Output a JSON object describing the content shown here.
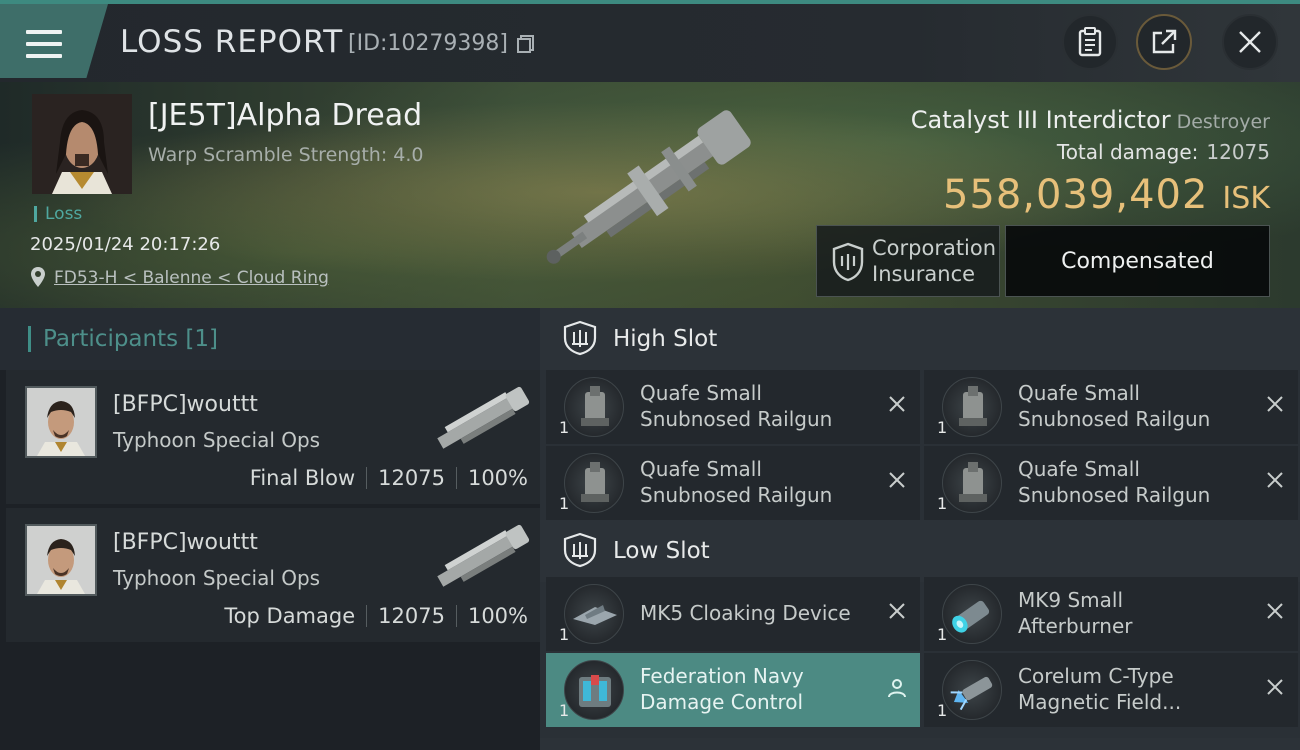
{
  "header": {
    "title": "LOSS REPORT",
    "report_id": "[ID:10279398]",
    "icons": [
      "menu-icon",
      "copy-icon",
      "clipboard-icon",
      "share-icon",
      "close-icon"
    ]
  },
  "victim": {
    "name": "[JE5T]Alpha Dread",
    "warp_scramble": "Warp Scramble Strength: 4.0",
    "status": "Loss",
    "timestamp": "2025/01/24 20:17:26",
    "location": "FD53-H < Balenne < Cloud Ring",
    "ship_name": "Catalyst III Interdictor",
    "ship_class": "Destroyer",
    "total_damage_label": "Total damage:",
    "total_damage": "12075",
    "isk_value": "558,039,402",
    "isk_unit": "ISK",
    "insurance_label_line1": "Corporation",
    "insurance_label_line2": "Insurance",
    "insurance_status": "Compensated"
  },
  "participants": {
    "title": "Participants [1]",
    "items": [
      {
        "name": "[BFPC]wouttt",
        "ship": "Typhoon Special Ops",
        "role": "Final Blow",
        "damage": "12075",
        "percent": "100%"
      },
      {
        "name": "[BFPC]wouttt",
        "ship": "Typhoon Special Ops",
        "role": "Top Damage",
        "damage": "12075",
        "percent": "100%"
      }
    ]
  },
  "fitting": {
    "high_slot": {
      "title": "High Slot",
      "modules": [
        {
          "line1": "Quafe Small",
          "line2": "Snubnosed Railgun",
          "qty": "1"
        },
        {
          "line1": "Quafe Small",
          "line2": "Snubnosed Railgun",
          "qty": "1"
        },
        {
          "line1": "Quafe Small",
          "line2": "Snubnosed Railgun",
          "qty": "1"
        },
        {
          "line1": "Quafe Small",
          "line2": "Snubnosed Railgun",
          "qty": "1"
        }
      ]
    },
    "low_slot": {
      "title": "Low Slot",
      "modules": [
        {
          "line1": "MK5 Cloaking Device",
          "qty": "1"
        },
        {
          "line1": "MK9 Small",
          "line2": "Afterburner",
          "qty": "1"
        },
        {
          "line1": "Federation Navy",
          "line2": "Damage Control",
          "qty": "1"
        },
        {
          "line1": "Corelum C-Type",
          "line2": "Magnetic Field...",
          "qty": "1"
        }
      ]
    }
  },
  "colors": {
    "accent": "#4c8a83",
    "isk": "#e7c07a",
    "teal_text": "#4fa8a0"
  }
}
